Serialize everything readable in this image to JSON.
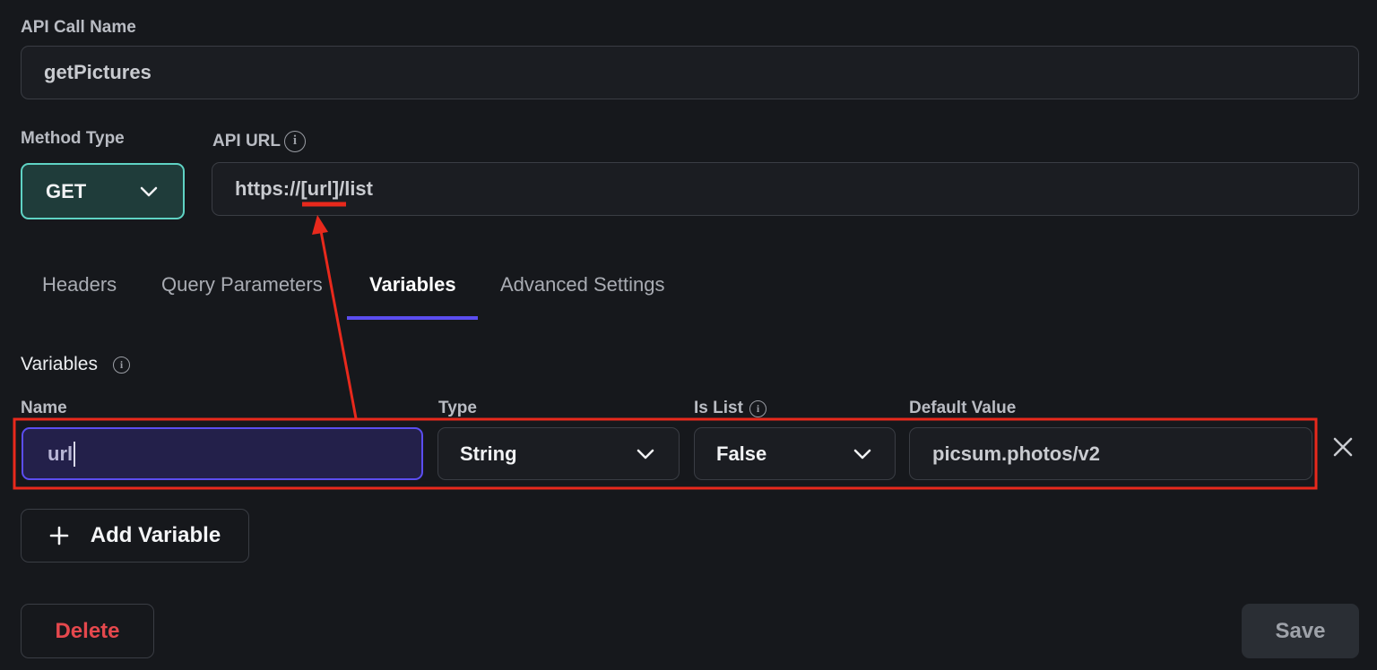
{
  "api_call_name": {
    "label": "API Call Name",
    "value": "getPictures"
  },
  "method_type": {
    "label": "Method Type",
    "value": "GET"
  },
  "api_url": {
    "label": "API URL",
    "value_prefix": "https://",
    "value_highlight": "[url]",
    "value_suffix": "/list"
  },
  "tabs": [
    {
      "label": "Headers"
    },
    {
      "label": "Query Parameters"
    },
    {
      "label": "Variables"
    },
    {
      "label": "Advanced Settings"
    }
  ],
  "variables": {
    "section_title": "Variables",
    "columns": {
      "name": "Name",
      "type": "Type",
      "is_list": "Is List",
      "default_value": "Default Value"
    },
    "rows": [
      {
        "name": "url",
        "type": "String",
        "is_list": "False",
        "default_value": "picsum.photos/v2"
      }
    ],
    "add_label": "Add Variable"
  },
  "actions": {
    "delete_label": "Delete",
    "save_label": "Save"
  },
  "colors": {
    "accent_teal": "#5fd3c4",
    "accent_purple": "#5b4df0",
    "annotation_red": "#e8291c",
    "delete_red": "#e5484d"
  },
  "icons": [
    "info-icon",
    "chevron-down-icon",
    "close-icon",
    "plus-icon",
    "arrow-annotation"
  ]
}
